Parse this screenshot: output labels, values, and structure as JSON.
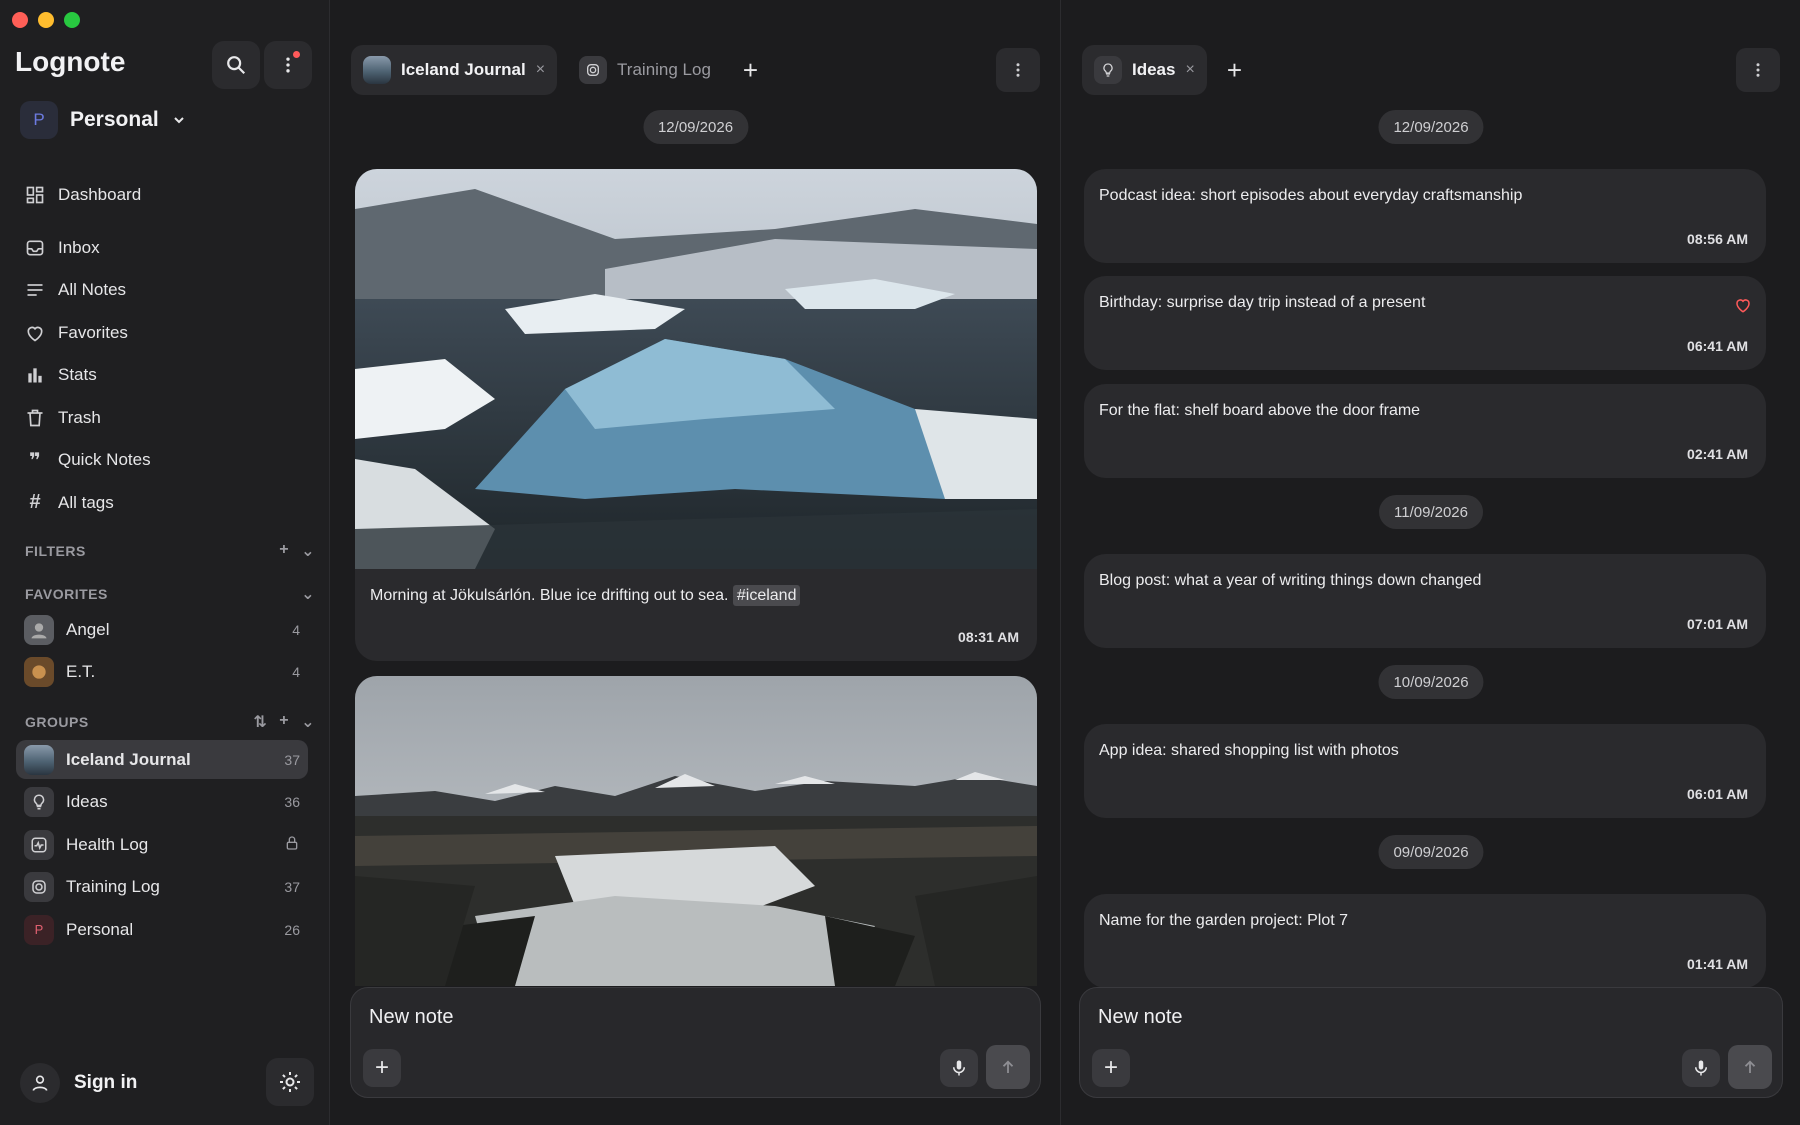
{
  "sidebar": {
    "brand": "Lognote",
    "workspace": {
      "initial": "P",
      "name": "Personal"
    },
    "nav": [
      {
        "label": "Dashboard",
        "icon": "dashboard-icon"
      },
      {
        "label": "Inbox",
        "icon": "inbox-icon"
      },
      {
        "label": "All Notes",
        "icon": "list-icon"
      },
      {
        "label": "Favorites",
        "icon": "heart-icon"
      },
      {
        "label": "Stats",
        "icon": "bar-chart-icon"
      },
      {
        "label": "Trash",
        "icon": "trash-icon"
      },
      {
        "label": "Quick Notes",
        "icon": "quote-icon"
      },
      {
        "label": "All tags",
        "icon": "hash-icon"
      }
    ],
    "filters_label": "FILTERS",
    "favorites_label": "FAVORITES",
    "favorites": [
      {
        "name": "Angel",
        "count": "4"
      },
      {
        "name": "E.T.",
        "count": "4"
      }
    ],
    "groups_label": "GROUPS",
    "groups": [
      {
        "name": "Iceland Journal",
        "count": "37"
      },
      {
        "name": "Ideas",
        "count": "36"
      },
      {
        "name": "Health Log",
        "count": ""
      },
      {
        "name": "Training Log",
        "count": "37"
      },
      {
        "name": "Personal",
        "count": "26",
        "initial": "P"
      }
    ],
    "sign_in": "Sign in"
  },
  "left_pane": {
    "tabs": [
      {
        "label": "Iceland Journal",
        "close": "×"
      },
      {
        "label": "Training Log"
      }
    ],
    "date": "12/09/2026",
    "note1": {
      "text": "Morning at Jökulsárlón. Blue ice drifting out to sea.",
      "tag": "#iceland",
      "time": "08:31 AM"
    },
    "composer_placeholder": "New note"
  },
  "right_pane": {
    "tabs": [
      {
        "label": "Ideas",
        "close": "×"
      }
    ],
    "dates": [
      "12/09/2026",
      "11/09/2026",
      "10/09/2026",
      "09/09/2026"
    ],
    "notes": [
      {
        "text": "Podcast idea: short episodes about everyday craftsmanship",
        "time": "08:56 AM"
      },
      {
        "text": "Birthday: surprise day trip instead of a present",
        "time": "06:41 AM"
      },
      {
        "text": "For the flat: shelf board above the door frame",
        "time": "02:41 AM"
      },
      {
        "text": "Blog post: what a year of writing things down changed",
        "time": "07:01 AM"
      },
      {
        "text": "App idea: shared shopping list with photos",
        "time": "06:01 AM"
      },
      {
        "text": "Name for the garden project: Plot 7",
        "time": "01:41 AM"
      }
    ],
    "composer_placeholder": "New note"
  },
  "colors": {
    "accent_red": "#ff5a5a",
    "background": "#1c1c1e",
    "card": "#2a2a2d"
  }
}
